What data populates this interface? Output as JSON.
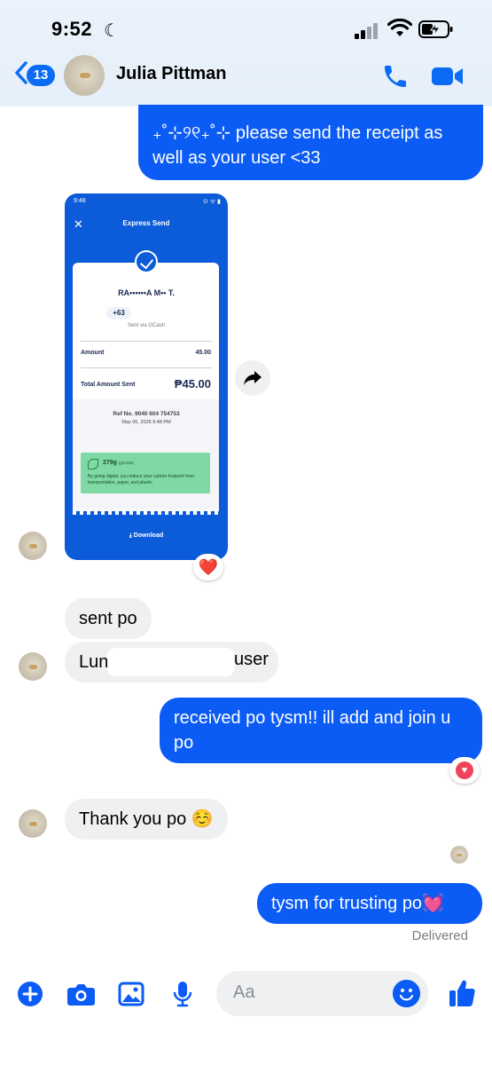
{
  "status_bar": {
    "time": "9:52",
    "focus_icon": "moon-icon",
    "signal_icon": "signal-icon",
    "wifi_icon": "wifi-icon",
    "battery_icon": "battery-charging-icon"
  },
  "header": {
    "back_count": "13",
    "contact_name": "Julia Pittman",
    "call_icon": "phone-icon",
    "video_icon": "video-icon"
  },
  "messages": [
    {
      "side": "sent",
      "text": "₊˚⊹୨୧₊˚⊹ please send the receipt as well as your user <33"
    },
    {
      "side": "received",
      "type": "image",
      "reaction": "❤️"
    },
    {
      "side": "received",
      "text": "sent po"
    },
    {
      "side": "received",
      "text_start": "Luna",
      "text_end": "user"
    },
    {
      "side": "sent",
      "text": "received po tysm!! ill add and join u po",
      "reaction": "♥"
    },
    {
      "side": "received",
      "text": "Thank you po ☺️"
    },
    {
      "side": "sent",
      "text": "tysm for trusting po💓",
      "status": "Delivered"
    }
  ],
  "receipt": {
    "time": "9:48",
    "status_icons": "⊙ ᯤ ▮",
    "title": "Express Send",
    "recipient": "RA••••••A M•• T.",
    "phone": "+63",
    "sent_via": "Sent via GCash",
    "amount_label": "Amount",
    "amount_value": "45.00",
    "total_label": "Total Amount Sent",
    "total_value": "₱45.00",
    "ref": "Ref No. 9040 604 754753",
    "date": "May 06, 2026 9:48 PM",
    "carbon": "279g",
    "carbon_unit": "(gCO2e)",
    "carbon_text": "By going digital, you reduce your carbon footprint from transportation, paper, and plastic.",
    "download": "Download"
  },
  "composer": {
    "placeholder": "Aa",
    "icons": [
      "plus-icon",
      "camera-icon",
      "image-icon",
      "microphone-icon",
      "emoji-icon",
      "thumbs-up-icon"
    ]
  },
  "colors": {
    "sent_bubble": "#0b5bf5",
    "received_bubble": "#eff0f2",
    "accent": "#0a6cf5"
  }
}
